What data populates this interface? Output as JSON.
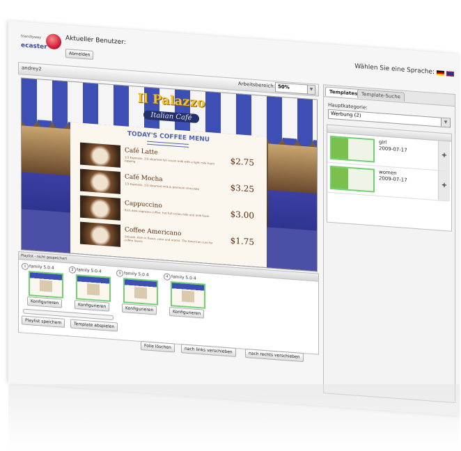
{
  "header": {
    "logo_sub": "friendlyway",
    "logo_brand": "ecaster",
    "current_user_label": "Aktueller Benutzer:",
    "logout_button": "Abmelden",
    "language_label": "Wählen Sie eine Sprache:"
  },
  "workspace": {
    "user": "andrey2",
    "label": "Arbeitsbereich:",
    "zoom": "50%"
  },
  "canvas": {
    "title": "Il Palazzo",
    "subtitle": "Italian Café",
    "menu_heading": "TODAY'S COFFEE MENU",
    "items": [
      {
        "name": "Café Latte",
        "desc": "1/3 Espresso, 2/3 steamed full cream milk with a light milk foam topping",
        "price": "$2.75"
      },
      {
        "name": "Café Mocha",
        "desc": "1/3 Espresso, 2/3 steamed milk & premium chocolate",
        "price": "$3.25"
      },
      {
        "name": "Cappuccino",
        "desc": "Rich dark espresso coffee, hot full cream milk and milk foam",
        "price": "$3.00"
      },
      {
        "name": "Coffee Americano",
        "desc": "Smooth. Rich in flavor, color and aroma. The American cure for coffee lovers",
        "price": "$1.75"
      }
    ]
  },
  "playlist": {
    "header": "Playlist - nicht gespeichert",
    "slides": [
      {
        "num": "1",
        "name": "family 5.0.4",
        "button": "Konfigurieren"
      },
      {
        "num": "2",
        "name": "family 5.0.4",
        "button": "Konfigurieren"
      },
      {
        "num": "3",
        "name": "family 5.0.4",
        "button": "Konfigurieren"
      },
      {
        "num": "4",
        "name": "family 5.0.4",
        "button": "Konfigurieren"
      }
    ],
    "save_button": "Playlist speichern",
    "play_button": "Template abspielen",
    "delete_button": "Folie löschen",
    "move_left_button": "nach links verschieben",
    "move_right_button": "nach rechts verschieben"
  },
  "sidebar": {
    "tabs": [
      "Templates",
      "Template-Suche"
    ],
    "category_label": "Hauptkategorie:",
    "category_value": "Werbung (2)",
    "templates": [
      {
        "name": "girl",
        "date": "2009-07-17",
        "add": "+"
      },
      {
        "name": "women",
        "date": "2009-07-17",
        "add": "+"
      }
    ]
  }
}
